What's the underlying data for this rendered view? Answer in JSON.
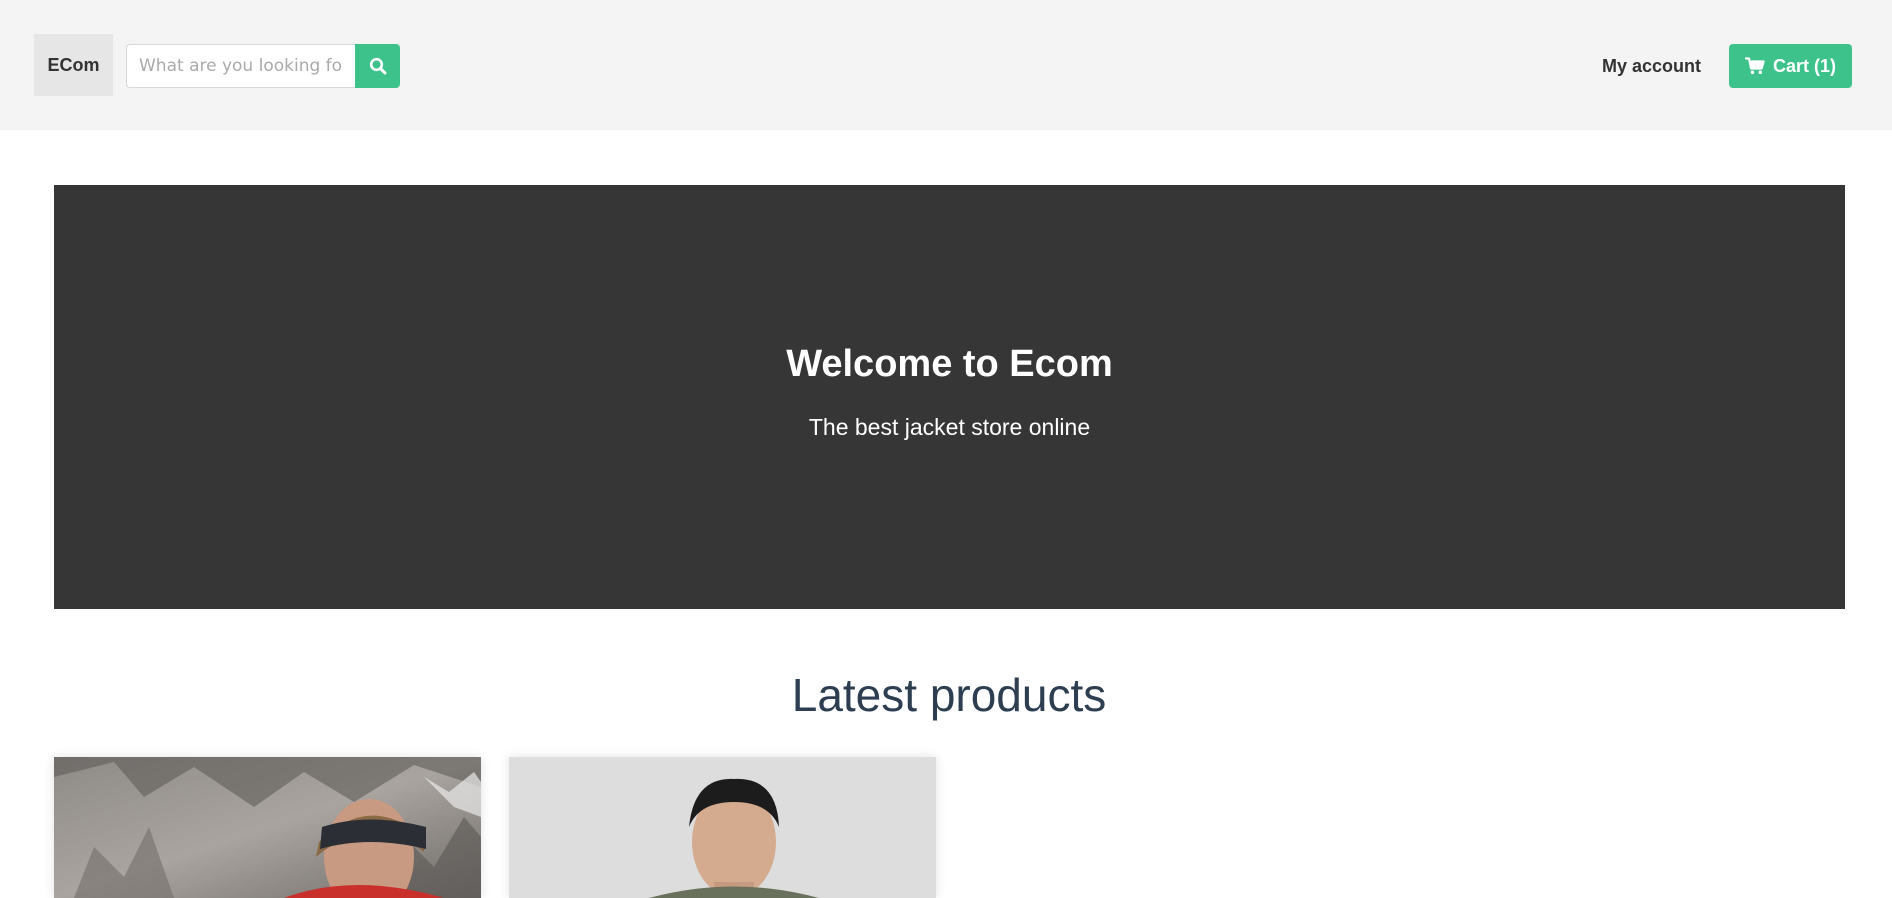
{
  "header": {
    "brand": "ECom",
    "search": {
      "placeholder": "What are you looking for?",
      "value": "",
      "button_icon": "search-icon"
    },
    "account_label": "My account",
    "cart_icon": "cart-icon",
    "cart_label": "Cart (1)"
  },
  "hero": {
    "title": "Welcome to Ecom",
    "subtitle": "The best jacket store online"
  },
  "latest": {
    "title": "Latest products",
    "products": [
      {
        "image": "product-image-red-jacket-mountain"
      },
      {
        "image": "product-image-olive-jacket"
      }
    ]
  },
  "colors": {
    "accent": "#3ec28c",
    "header_bg": "#f4f4f4",
    "hero_bg": "#363636",
    "section_title": "#2c3e50"
  }
}
